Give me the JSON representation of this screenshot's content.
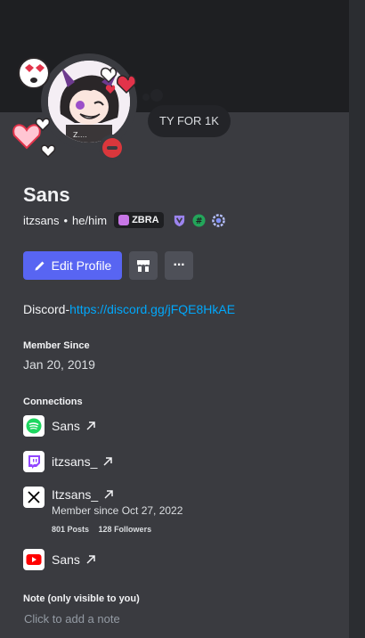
{
  "profile": {
    "display_name": "Sans",
    "username": "itzsans",
    "pronouns": "he/him",
    "clan_tag": "ZBRA",
    "status_text": "TY FOR 1K",
    "status": "dnd"
  },
  "actions": {
    "edit_profile_label": "Edit Profile",
    "more_label": "···"
  },
  "bio": {
    "prefix": "Discord-",
    "link": "https://discord.gg/jFQE8HkAE"
  },
  "member_since": {
    "title": "Member Since",
    "value": "Jan 20, 2019"
  },
  "connections": {
    "title": "Connections",
    "items": [
      {
        "service": "spotify",
        "icon": "spotify-icon",
        "name": "Sans"
      },
      {
        "service": "twitch",
        "icon": "twitch-icon",
        "name": "itzsans_"
      },
      {
        "service": "x",
        "icon": "x-icon",
        "name": "Itzsans_",
        "member_since": "Member since Oct 27, 2022",
        "posts": "801 Posts",
        "followers": "128 Followers"
      },
      {
        "service": "youtube",
        "icon": "youtube-icon",
        "name": "Sans"
      }
    ]
  },
  "note": {
    "title": "Note (only visible to you)",
    "placeholder": "Click to add a note"
  },
  "colors": {
    "accent": "#5865f2",
    "dnd": "#da373c",
    "link": "#00a8fc"
  }
}
